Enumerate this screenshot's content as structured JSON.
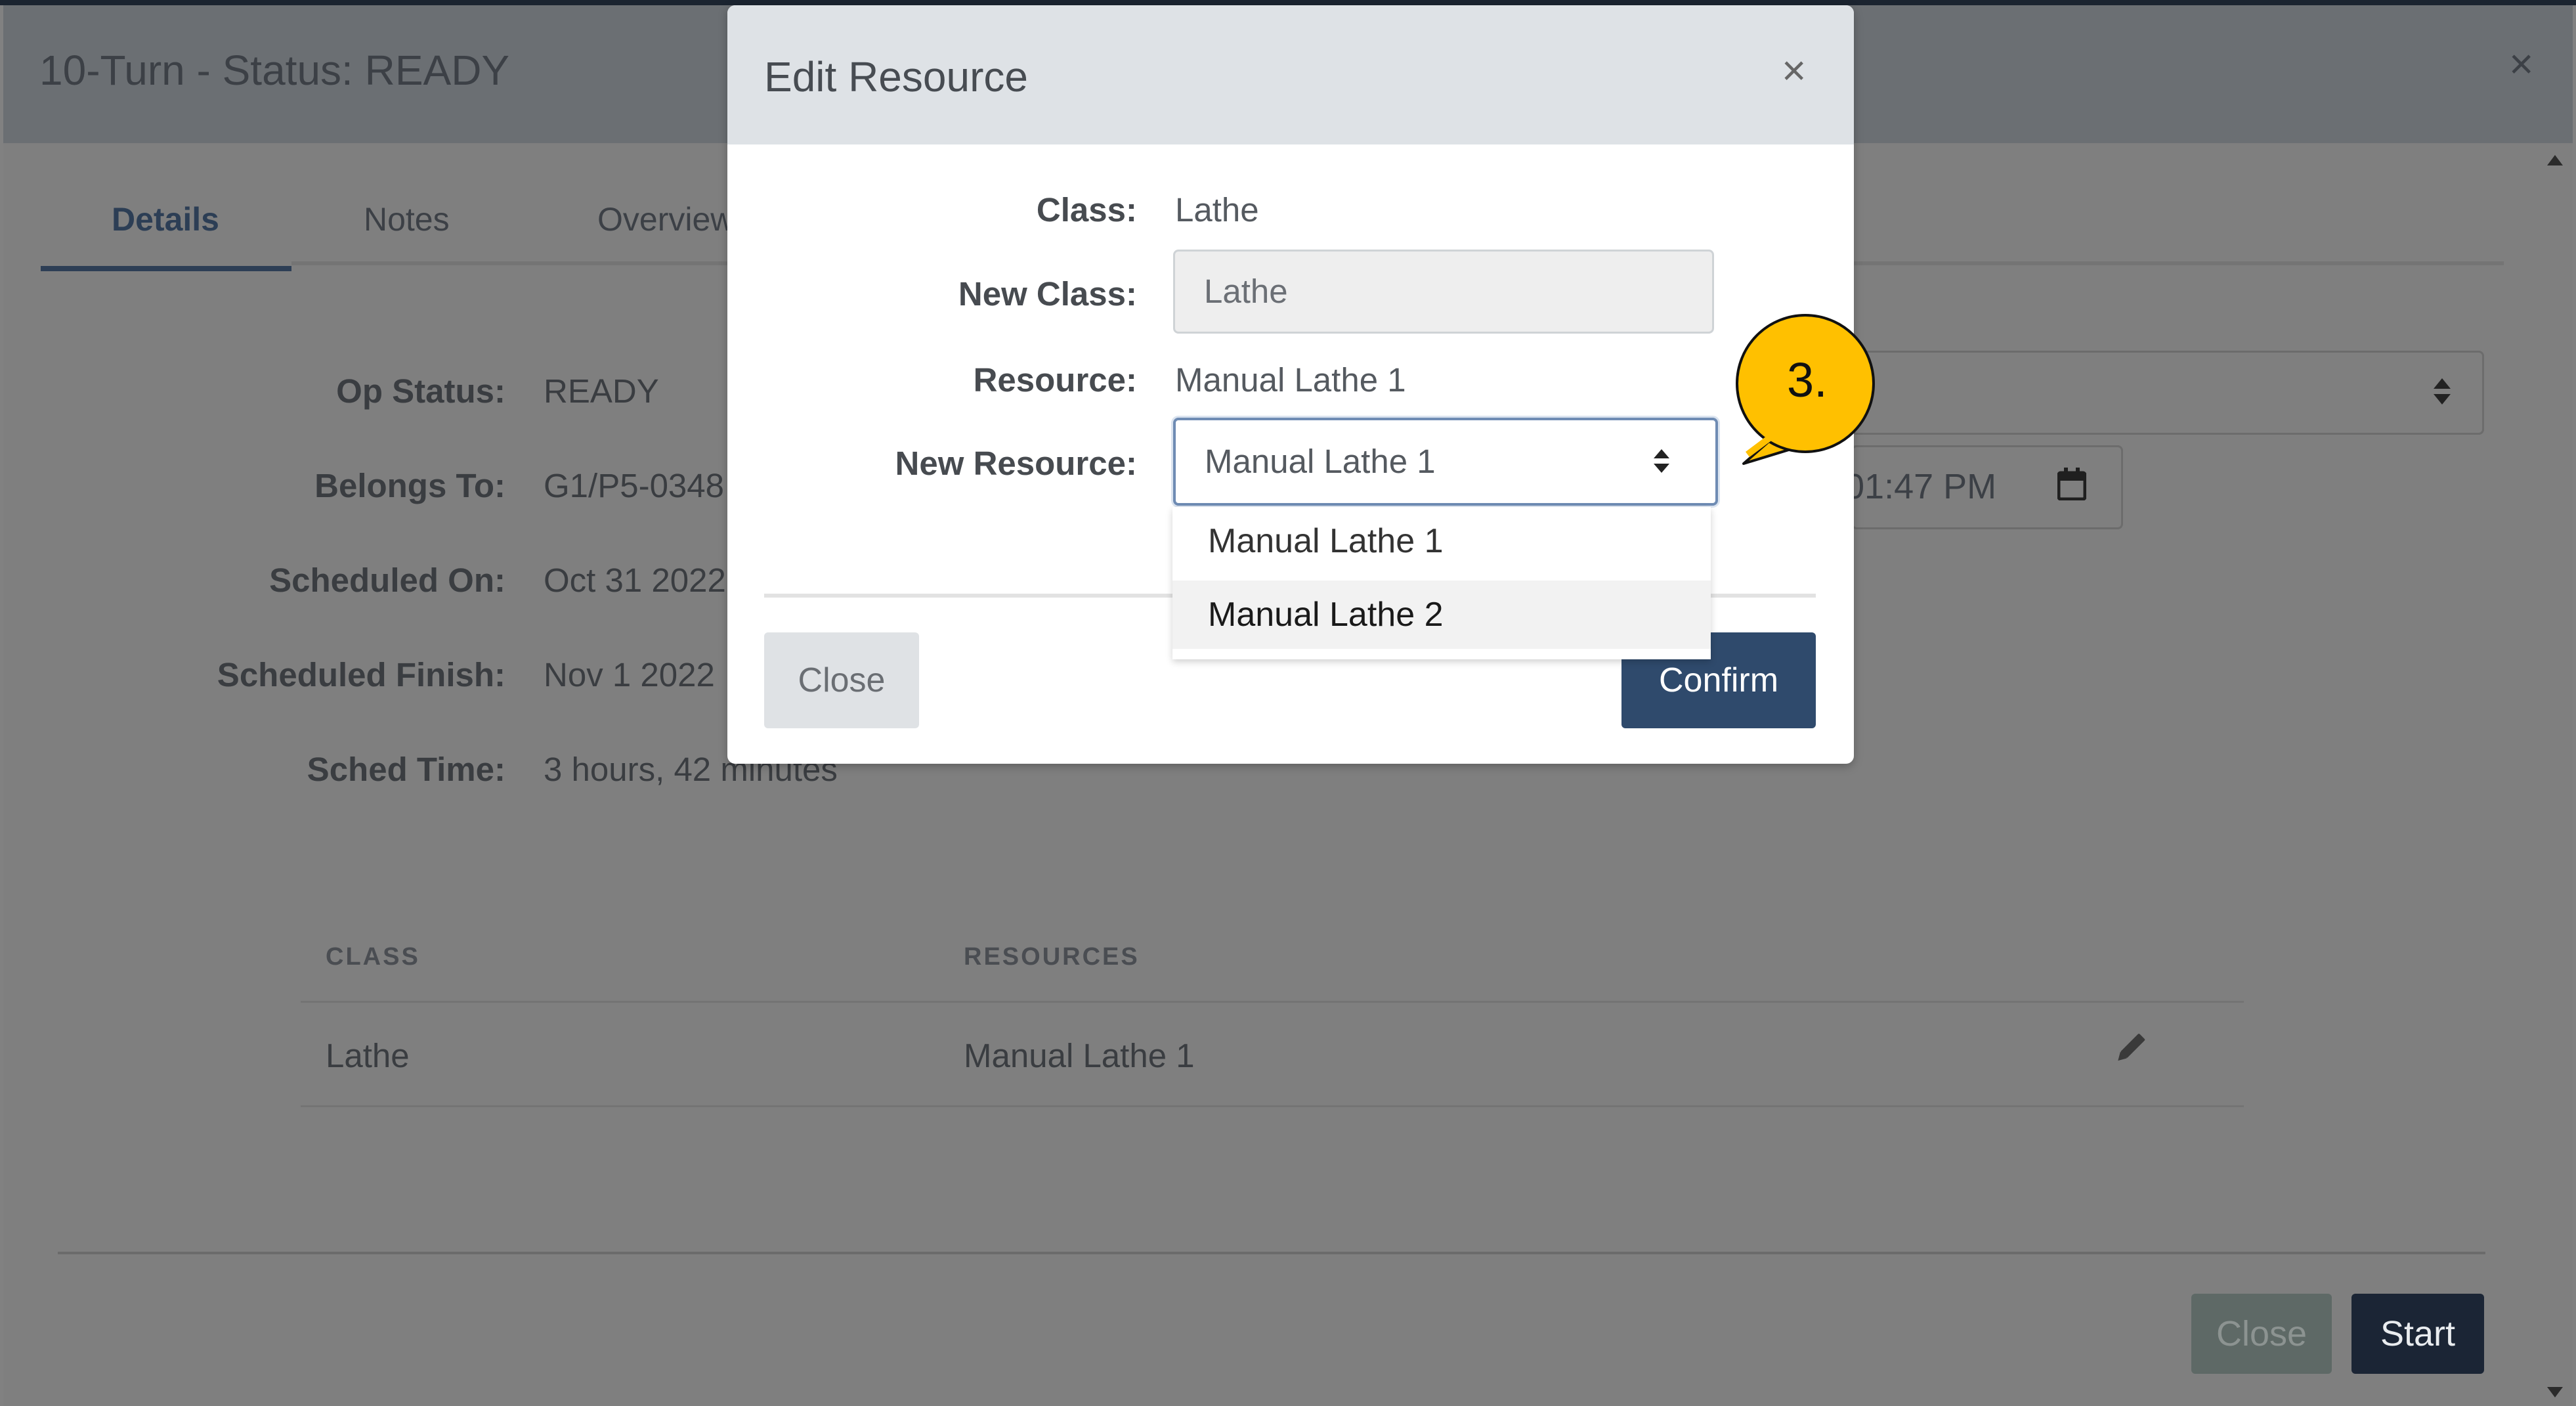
{
  "background_modal": {
    "title": "10-Turn - Status: READY",
    "close_icon": "×",
    "tabs": [
      {
        "label": "Details"
      },
      {
        "label": "Notes"
      },
      {
        "label": "Overview"
      }
    ],
    "fields": [
      {
        "label": "Op Status:",
        "value": "READY"
      },
      {
        "label": "Belongs To:",
        "value": "G1/P5-0348"
      },
      {
        "label": "Scheduled On:",
        "value": "Oct 31 2022"
      },
      {
        "label": "Scheduled Finish:",
        "value": "Nov 1 2022"
      },
      {
        "label": "Sched Time:",
        "value": "3 hours, 42 minutes"
      }
    ],
    "date_input_value": "01:47 PM",
    "table": {
      "headers": [
        "CLASS",
        "RESOURCES"
      ],
      "rows": [
        {
          "class": "Lathe",
          "resources": "Manual Lathe 1"
        }
      ]
    },
    "footer": {
      "close_label": "Close",
      "start_label": "Start"
    }
  },
  "dialog": {
    "title": "Edit Resource",
    "close_icon": "×",
    "class_label": "Class:",
    "class_value": "Lathe",
    "new_class_label": "New Class:",
    "new_class_value": "Lathe",
    "resource_label": "Resource:",
    "resource_value": "Manual Lathe 1",
    "new_resource_label": "New Resource:",
    "new_resource_selected": "Manual Lathe 1",
    "dropdown_options": [
      "Manual Lathe 1",
      "Manual Lathe 2"
    ],
    "close_label": "Close",
    "confirm_label": "Confirm"
  },
  "callout": {
    "label": "3.",
    "fill_color": "#FFC000"
  },
  "colors": {
    "primary": "#2F4A6C",
    "start_button": "#1B2535",
    "overlay": "#818181"
  }
}
